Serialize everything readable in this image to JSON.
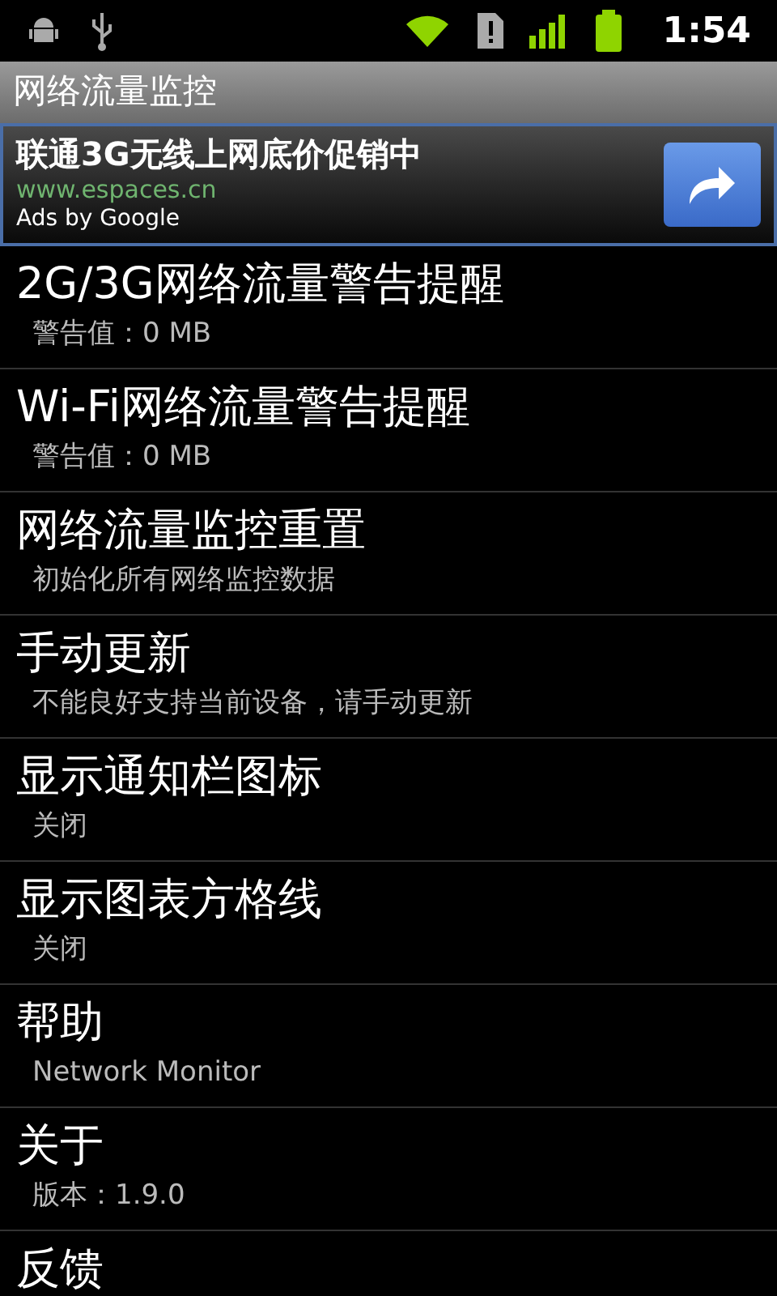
{
  "status_bar": {
    "time": "1:54"
  },
  "window": {
    "title": "网络流量监控"
  },
  "ad": {
    "headline": "联通3G无线上网底价促销中",
    "url": "www.espaces.cn",
    "attribution": "Ads by Google"
  },
  "settings": [
    {
      "title": "2G/3G网络流量警告提醒",
      "summary": "警告值：0 MB"
    },
    {
      "title": "Wi-Fi网络流量警告提醒",
      "summary": "警告值：0 MB"
    },
    {
      "title": "网络流量监控重置",
      "summary": "初始化所有网络监控数据"
    },
    {
      "title": "手动更新",
      "summary": "不能良好支持当前设备，请手动更新"
    },
    {
      "title": "显示通知栏图标",
      "summary": "关闭"
    },
    {
      "title": "显示图表方格线",
      "summary": "关闭"
    },
    {
      "title": "帮助",
      "summary": "Network Monitor"
    },
    {
      "title": "关于",
      "summary": "版本：1.9.0"
    },
    {
      "title": "反馈"
    }
  ]
}
